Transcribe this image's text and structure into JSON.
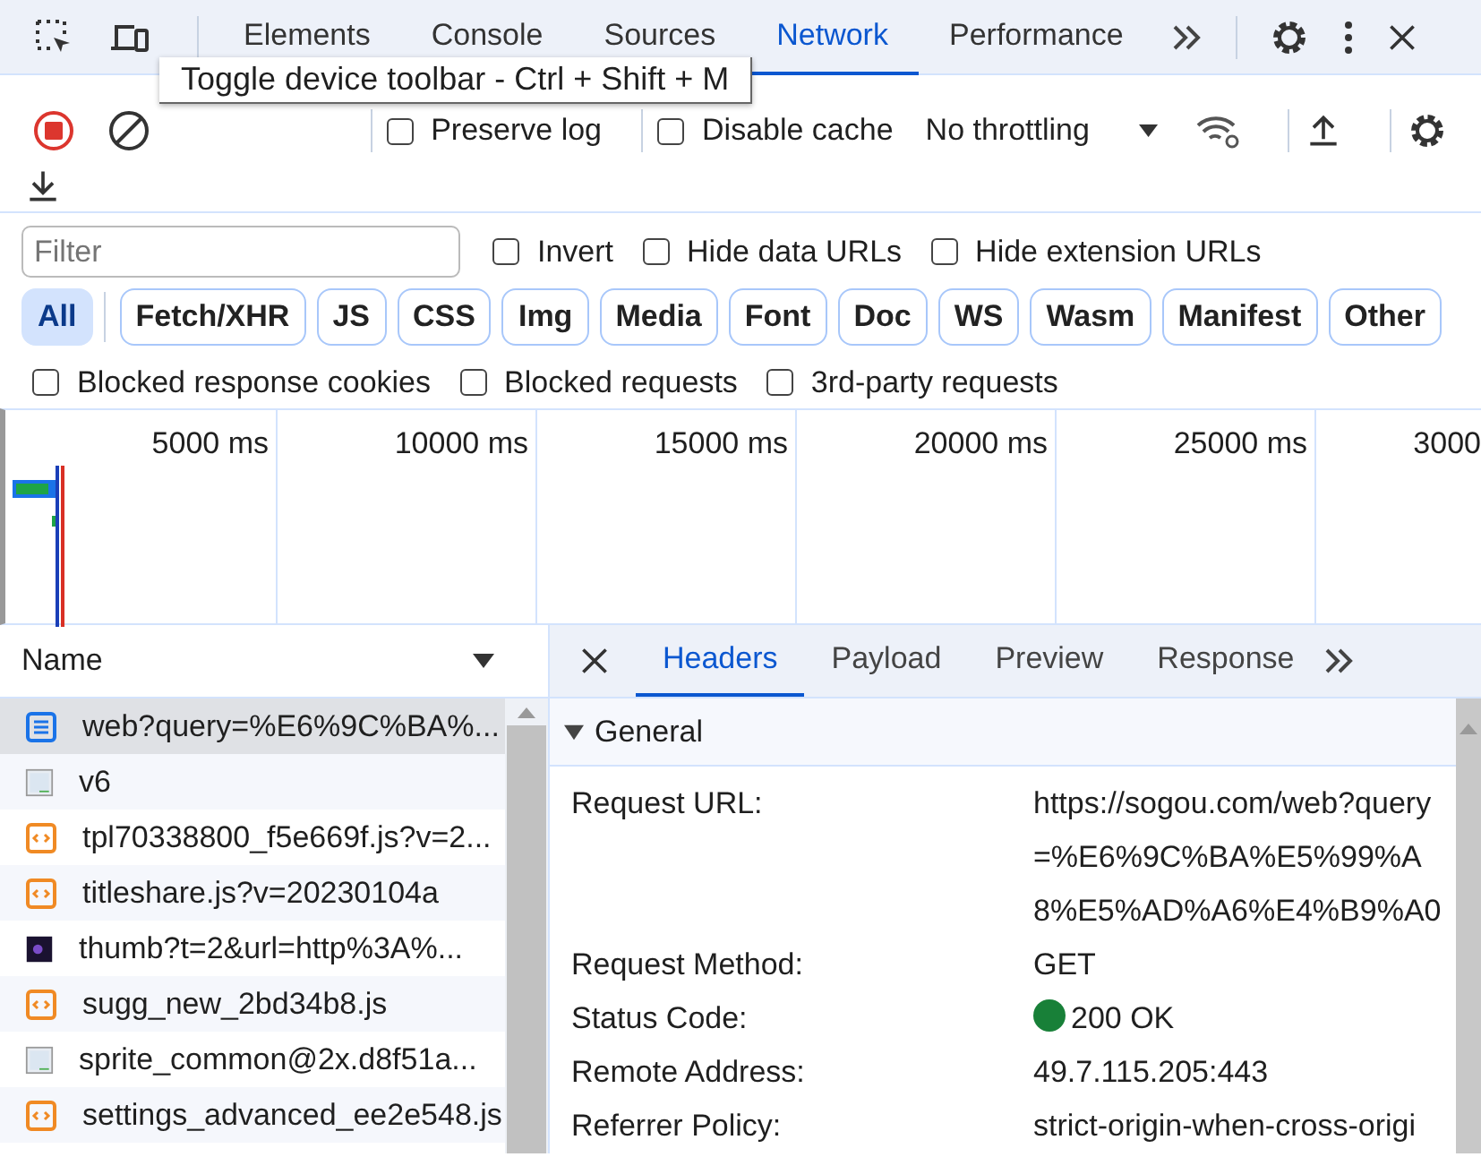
{
  "main_tabs": [
    {
      "label": "Elements",
      "selected": false
    },
    {
      "label": "Console",
      "selected": false
    },
    {
      "label": "Sources",
      "selected": false
    },
    {
      "label": "Network",
      "selected": true
    },
    {
      "label": "Performance",
      "selected": false
    }
  ],
  "tooltip": "Toggle device toolbar - Ctrl + Shift + M",
  "toolbar": {
    "recording": true,
    "checkboxes": [
      {
        "label": "Preserve log",
        "checked": false
      },
      {
        "label": "Disable cache",
        "checked": false
      }
    ],
    "throttling": "No throttling"
  },
  "filter": {
    "placeholder": "Filter",
    "options": [
      {
        "label": "Invert",
        "checked": false
      },
      {
        "label": "Hide data URLs",
        "checked": false
      },
      {
        "label": "Hide extension URLs",
        "checked": false
      }
    ]
  },
  "type_filters": [
    {
      "label": "All",
      "selected": true
    },
    {
      "label": "Fetch/XHR",
      "selected": false
    },
    {
      "label": "JS",
      "selected": false
    },
    {
      "label": "CSS",
      "selected": false
    },
    {
      "label": "Img",
      "selected": false
    },
    {
      "label": "Media",
      "selected": false
    },
    {
      "label": "Font",
      "selected": false
    },
    {
      "label": "Doc",
      "selected": false
    },
    {
      "label": "WS",
      "selected": false
    },
    {
      "label": "Wasm",
      "selected": false
    },
    {
      "label": "Manifest",
      "selected": false
    },
    {
      "label": "Other",
      "selected": false
    }
  ],
  "extra_filters": [
    {
      "label": "Blocked response cookies",
      "checked": false
    },
    {
      "label": "Blocked requests",
      "checked": false
    },
    {
      "label": "3rd-party requests",
      "checked": false
    }
  ],
  "timeline": {
    "ticks": [
      "5000 ms",
      "10000 ms",
      "15000 ms",
      "20000 ms",
      "25000 ms",
      "3000"
    ]
  },
  "requests": {
    "column": "Name",
    "rows": [
      {
        "name": "web?query=%E6%9C%BA%...",
        "kind": "document",
        "selected": true
      },
      {
        "name": "v6",
        "kind": "image",
        "selected": false
      },
      {
        "name": "tpl70338800_f5e669f.js?v=2...",
        "kind": "script",
        "selected": false
      },
      {
        "name": "titleshare.js?v=20230104a",
        "kind": "script",
        "selected": false
      },
      {
        "name": "thumb?t=2&url=http%3A%...",
        "kind": "thumbnail",
        "selected": false
      },
      {
        "name": "sugg_new_2bd34b8.js",
        "kind": "script",
        "selected": false
      },
      {
        "name": "sprite_common@2x.d8f51a...",
        "kind": "image",
        "selected": false
      },
      {
        "name": "settings_advanced_ee2e548.js",
        "kind": "script",
        "selected": false
      }
    ]
  },
  "details": {
    "tabs": [
      {
        "label": "Headers",
        "selected": true
      },
      {
        "label": "Payload",
        "selected": false
      },
      {
        "label": "Preview",
        "selected": false
      },
      {
        "label": "Response",
        "selected": false
      }
    ],
    "section": {
      "title": "General",
      "expanded": true
    },
    "fields": [
      {
        "label": "Request URL:",
        "value": "https://sogou.com/web?query=%E6%9C%BA%E5%99%A8%E5%AD%A6%E4%B9%A0"
      },
      {
        "label": "Request Method:",
        "value": "GET"
      },
      {
        "label": "Status Code:",
        "value": "200 OK",
        "color": "#188038"
      },
      {
        "label": "Remote Address:",
        "value": "49.7.115.205:443"
      },
      {
        "label": "Referrer Policy:",
        "value": "strict-origin-when-cross-origi"
      }
    ]
  }
}
